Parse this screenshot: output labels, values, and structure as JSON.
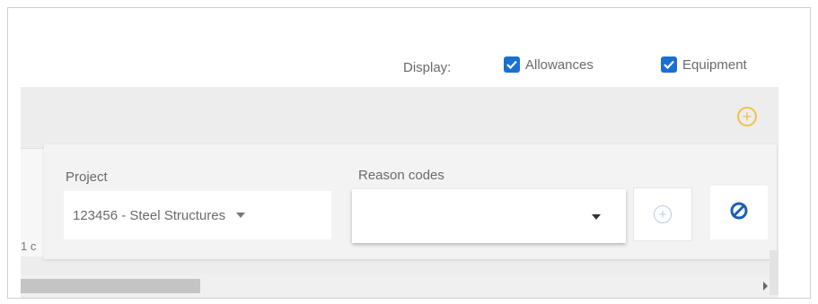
{
  "display": {
    "label": "Display:",
    "options": [
      {
        "label": "Allowances",
        "checked": true
      },
      {
        "label": "Equipment",
        "checked": true
      }
    ]
  },
  "filters": {
    "project_label": "Project",
    "project_value": "123456 - Steel Structures",
    "reason_label": "Reason codes",
    "reason_value": ""
  },
  "partial_text": "1 c",
  "colors": {
    "checkbox": "#1a6fd0",
    "add_accent": "#f0c24a",
    "clear_icon": "#1a5fb4"
  },
  "icons": {
    "add_top": "plus-circle-icon",
    "add_reason": "plus-circle-icon",
    "clear": "prohibit-icon",
    "checkbox": "check-icon"
  }
}
